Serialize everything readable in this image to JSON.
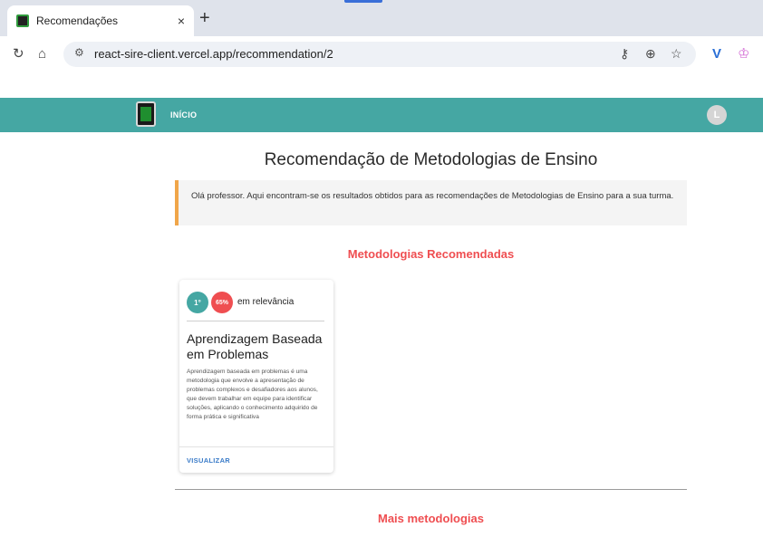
{
  "browser": {
    "tab_title": "Recomendações",
    "tab_close": "×",
    "new_tab": "+",
    "url": "react-sire-client.vercel.app/recommendation/2",
    "icons": [
      "reload-icon",
      "home-icon",
      "site-info-icon",
      "password-key-icon",
      "zoom-icon",
      "bookmark-star-icon",
      "extension-v-icon",
      "extension-crown-icon"
    ]
  },
  "app": {
    "nav_home": "INÍCIO",
    "avatar_letter": "L",
    "accent_color": "#45a7a3",
    "highlight_color": "#ef4e51"
  },
  "page": {
    "title": "Recomendação de Metodologias de Ensino",
    "info_text": "Olá professor. Aqui encontram-se os resultados obtidos para as recomendações de Metodologias de Ensino para a sua turma.",
    "recommended_heading": "Metodologias Recomendadas",
    "more_heading": "Mais metodologias"
  },
  "cards": [
    {
      "rank": "1°",
      "percent": "65%",
      "relevance_label": "em relevância",
      "title": "Aprendizagem Baseada em Problemas",
      "description": "Aprendizagem baseada em problemas é uma metodologia que envolve a apresentação de problemas complexos e desafiadores aos alunos, que devem trabalhar em equipe para identificar soluções, aplicando o conhecimento adquirido de forma prática e significativa",
      "action": "VISUALIZAR"
    }
  ]
}
